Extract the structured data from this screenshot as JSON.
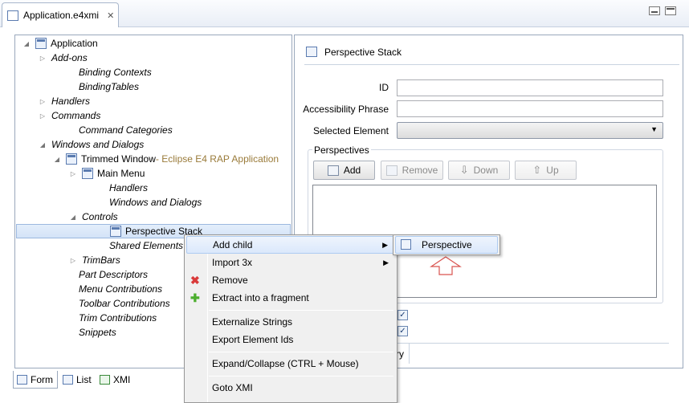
{
  "editor_tab": {
    "title": "Application.e4xmi",
    "close": "✕"
  },
  "tree": [
    {
      "label": "Application",
      "italic": false,
      "arrow": "◢",
      "icon": "application-icon"
    },
    {
      "label": "Add-ons",
      "italic": true,
      "arrow": "▷"
    },
    {
      "label": "Binding Contexts",
      "italic": true,
      "arrow": ""
    },
    {
      "label": "BindingTables",
      "italic": true,
      "arrow": ""
    },
    {
      "label": "Handlers",
      "italic": true,
      "arrow": "▷"
    },
    {
      "label": "Commands",
      "italic": true,
      "arrow": "▷"
    },
    {
      "label": "Command Categories",
      "italic": true,
      "arrow": ""
    },
    {
      "label": "Windows and Dialogs",
      "italic": true,
      "arrow": "◢"
    },
    {
      "label": "Trimmed Window",
      "suffix": " - Eclipse E4 RAP Application",
      "italic": false,
      "arrow": "◢",
      "icon": "window-icon"
    },
    {
      "label": "Main Menu",
      "italic": false,
      "arrow": "▷",
      "icon": "menu-icon"
    },
    {
      "label": "Handlers",
      "italic": true,
      "arrow": ""
    },
    {
      "label": "Windows and Dialogs",
      "italic": true,
      "arrow": ""
    },
    {
      "label": "Controls",
      "italic": true,
      "arrow": "◢"
    },
    {
      "label": "Perspective Stack",
      "italic": false,
      "arrow": "",
      "icon": "perspective-stack-icon",
      "selected": true
    },
    {
      "label": "Shared Elements",
      "italic": true,
      "arrow": ""
    },
    {
      "label": "TrimBars",
      "italic": true,
      "arrow": "▷"
    },
    {
      "label": "Part Descriptors",
      "italic": true,
      "arrow": ""
    },
    {
      "label": "Menu Contributions",
      "italic": true,
      "arrow": ""
    },
    {
      "label": "Toolbar Contributions",
      "italic": true,
      "arrow": ""
    },
    {
      "label": "Trim Contributions",
      "italic": true,
      "arrow": ""
    },
    {
      "label": "Snippets",
      "italic": true,
      "arrow": ""
    }
  ],
  "bottom_tabs": [
    "Form",
    "List",
    "XMI"
  ],
  "detail": {
    "title": "Perspective Stack",
    "id_label": "ID",
    "id_value": "",
    "accessibility_label": "Accessibility Phrase",
    "accessibility_value": "",
    "selected_element_label": "Selected Element",
    "selected_element_value": "",
    "perspectives_label": "Perspectives",
    "buttons": {
      "add": "Add",
      "remove": "Remove",
      "down": "Down",
      "up": "Up"
    },
    "partial_label": "ry"
  },
  "context_menu": {
    "items": [
      {
        "label": "Add child",
        "submenu": true,
        "highlighted": true
      },
      {
        "label": "Import 3x",
        "submenu": true
      },
      {
        "label": "Remove",
        "icon": "remove-icon"
      },
      {
        "label": "Extract into a fragment",
        "icon": "extract-icon"
      },
      {
        "label": "Externalize Strings"
      },
      {
        "label": "Export Element Ids"
      },
      {
        "label": "Expand/Collapse (CTRL + Mouse)"
      },
      {
        "label": "Goto XMI"
      }
    ],
    "submenu_arrow": "▶"
  },
  "submenu": {
    "items": [
      {
        "label": "Perspective",
        "icon": "perspective-icon"
      }
    ]
  },
  "colors": {
    "selection": "#d3e3f7",
    "tag": "#9a7b3a",
    "annotation_arrow": "#d9534f",
    "remove_icon": "#d93a3a",
    "extract_icon": "#4cae2e"
  }
}
